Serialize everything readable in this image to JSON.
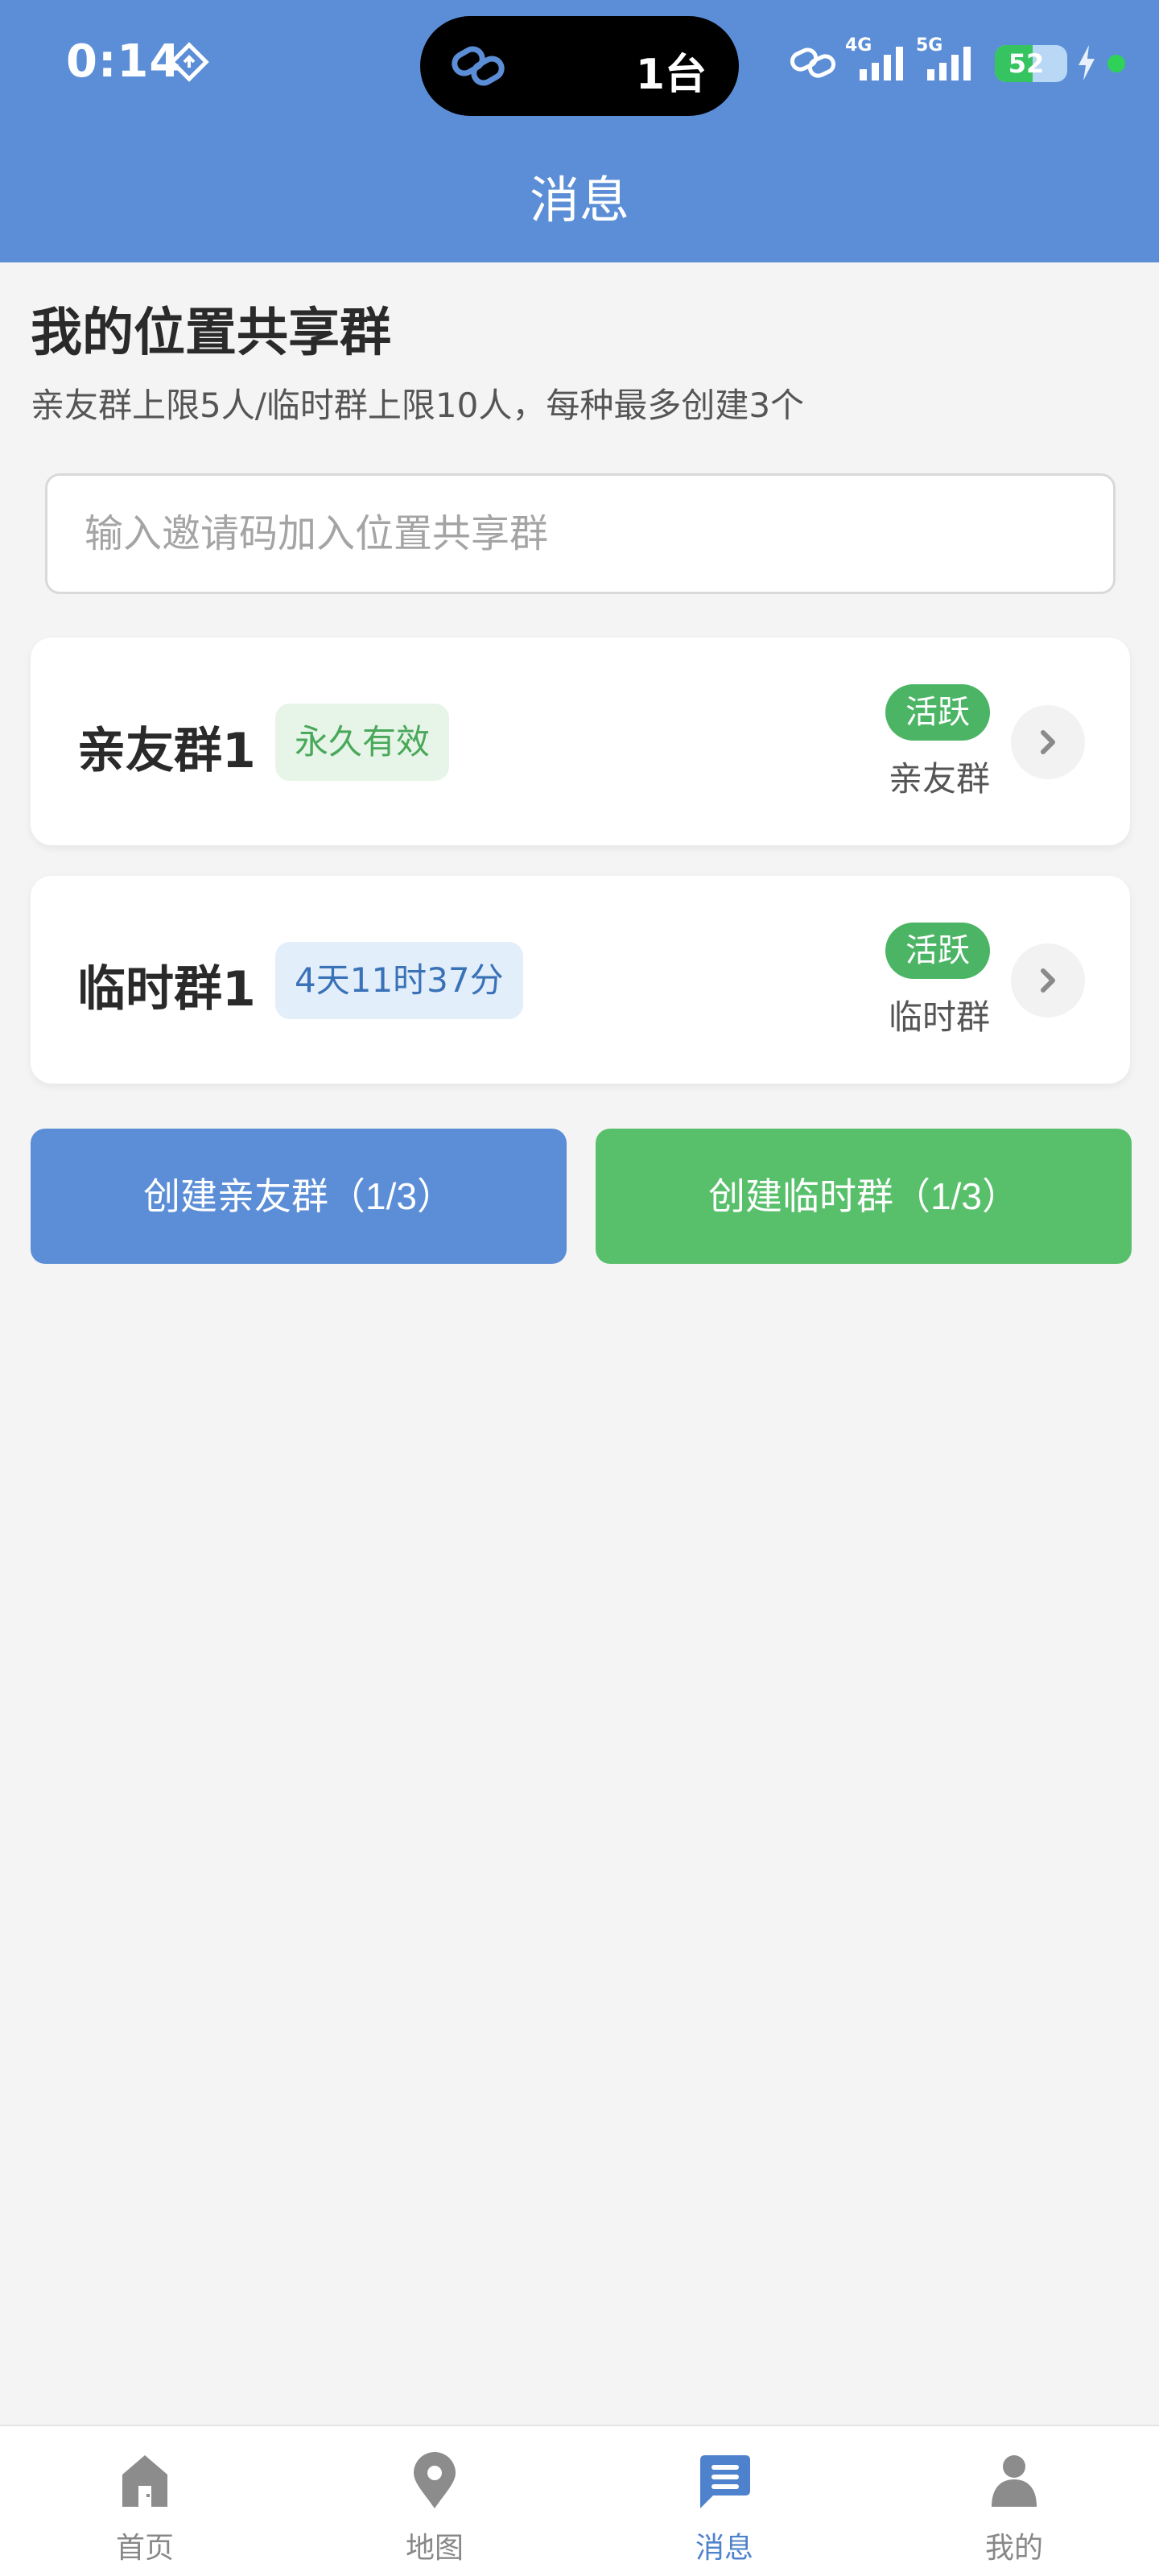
{
  "status_bar": {
    "time": "0:14",
    "island_text": "1台",
    "network_1": "4G",
    "network_2": "5G",
    "battery_percent": 52,
    "battery_label": "52"
  },
  "header": {
    "title": "消息"
  },
  "section": {
    "title": "我的位置共享群",
    "subtitle": "亲友群上限5人/临时群上限10人，每种最多创建3个"
  },
  "invite": {
    "placeholder": "输入邀请码加入位置共享群",
    "value": ""
  },
  "groups": [
    {
      "name": "亲友群1",
      "expiry": "永久有效",
      "status": "活跃",
      "type": "亲友群"
    },
    {
      "name": "临时群1",
      "expiry": "4天11时37分",
      "status": "活跃",
      "type": "临时群"
    }
  ],
  "actions": {
    "create_family": "创建亲友群（1/3）",
    "create_temp": "创建临时群（1/3）"
  },
  "bottom_nav": {
    "active": "消息",
    "items": [
      {
        "label": "首页",
        "icon": "home-icon"
      },
      {
        "label": "地图",
        "icon": "map-pin-icon"
      },
      {
        "label": "消息",
        "icon": "message-icon"
      },
      {
        "label": "我的",
        "icon": "user-icon"
      }
    ]
  },
  "colors": {
    "primary": "#5b8ed6",
    "green": "#58bf6b",
    "active_badge": "#4cb565",
    "background": "#f4f4f5"
  }
}
